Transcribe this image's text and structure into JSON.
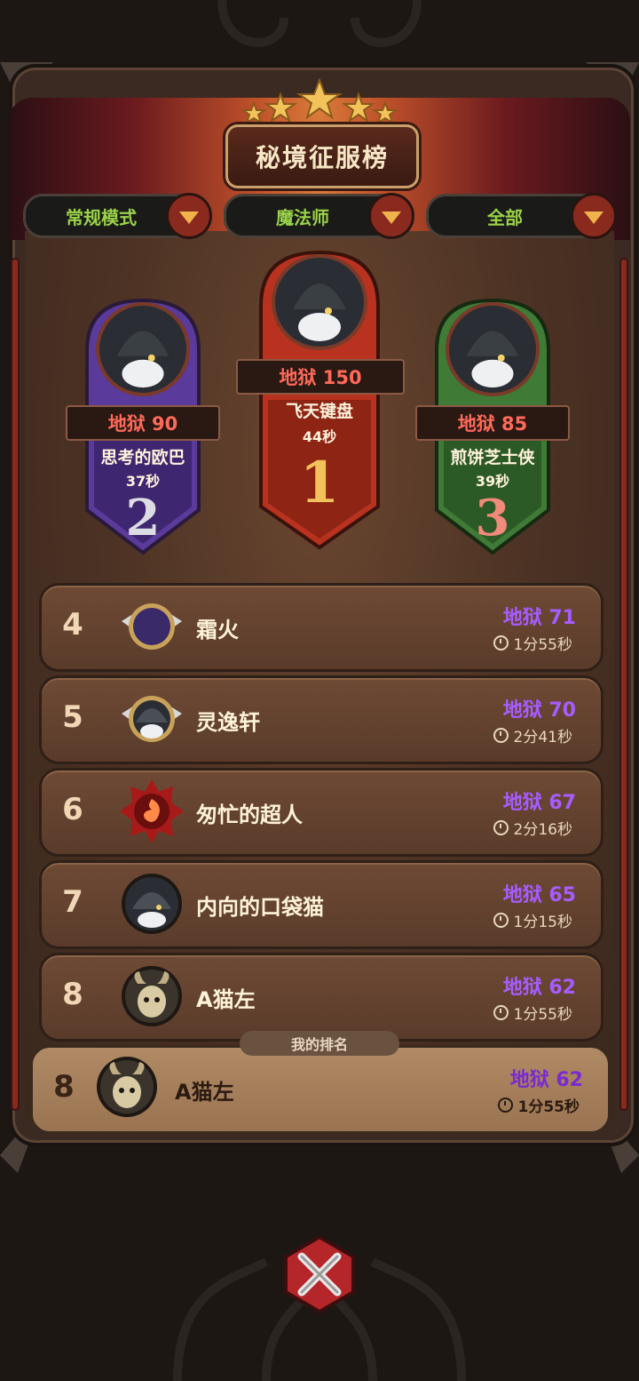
{
  "title": "秘境征服榜",
  "filters": [
    {
      "label": "常规模式"
    },
    {
      "label": "魔法师"
    },
    {
      "label": "全部"
    }
  ],
  "podium": {
    "first": {
      "hell": "地狱 150",
      "name": "飞天键盘",
      "time": "44秒",
      "rank": "1"
    },
    "second": {
      "hell": "地狱 90",
      "name": "思考的欧巴",
      "time": "37秒",
      "rank": "2"
    },
    "third": {
      "hell": "地狱 85",
      "name": "煎饼芝士侠",
      "time": "39秒",
      "rank": "3"
    }
  },
  "rows": [
    {
      "rank": "4",
      "name": "霜火",
      "hell": "地狱 71",
      "time": "1分55秒",
      "avatar": "frost-moon-emblem"
    },
    {
      "rank": "5",
      "name": "灵逸轩",
      "hell": "地狱 70",
      "time": "2分41秒",
      "avatar": "wizard-hat-avatar"
    },
    {
      "rank": "6",
      "name": "匆忙的超人",
      "hell": "地狱 67",
      "time": "2分16秒",
      "avatar": "fire-swirl-emblem"
    },
    {
      "rank": "7",
      "name": "内向的口袋猫",
      "hell": "地狱 65",
      "time": "1分15秒",
      "avatar": "wizard-hat-avatar"
    },
    {
      "rank": "8",
      "name": "A猫左",
      "hell": "地狱 62",
      "time": "1分55秒",
      "avatar": "horned-imp-avatar"
    }
  ],
  "my_rank": {
    "tag": "我的排名",
    "rank": "8",
    "name": "A猫左",
    "hell": "地狱 62",
    "time": "1分55秒"
  },
  "colors": {
    "hell_purple": "#a85cff",
    "hell_red": "#ff6a5a",
    "filter_green": "#9ad248",
    "close_red": "#b5262a"
  }
}
